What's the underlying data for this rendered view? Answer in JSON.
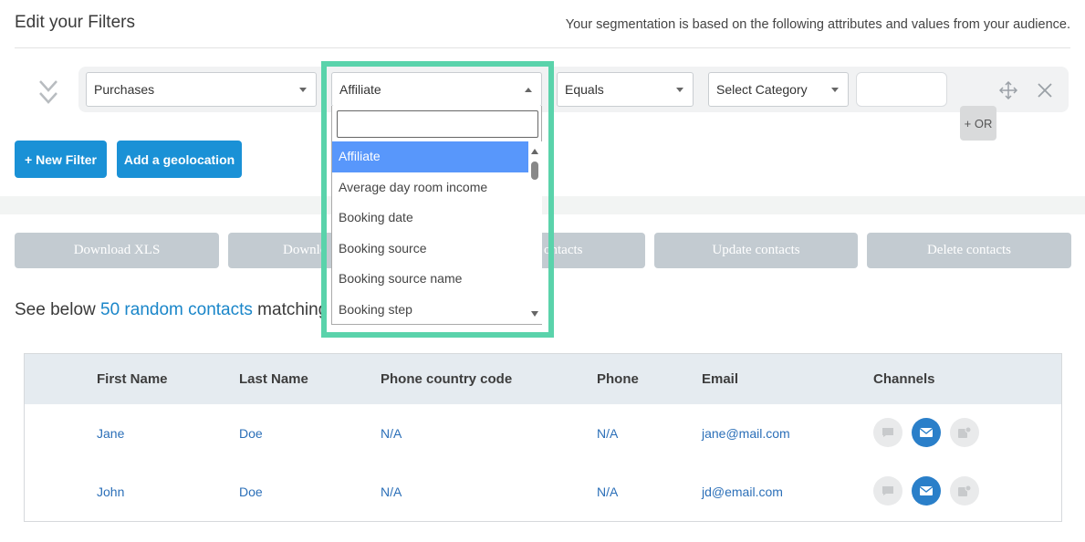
{
  "header": {
    "title": "Edit your Filters",
    "description": "Your segmentation is based on the following attributes and values from your audience."
  },
  "filter": {
    "attribute": "Purchases",
    "field": "Affiliate",
    "operator": "Equals",
    "category": "Select Category",
    "value": "",
    "or_label": "+ OR"
  },
  "dropdown": {
    "search_value": "",
    "options": [
      "Affiliate",
      "Average day room income",
      "Booking date",
      "Booking source",
      "Booking source name",
      "Booking step"
    ],
    "selected": "Affiliate"
  },
  "actions": {
    "new_filter": "+ New Filter",
    "add_geolocation": "Add a geolocation"
  },
  "export_buttons": {
    "download_xls": "Download XLS",
    "download_csv_partial": "Downlo",
    "contacts_partial": "ontacts",
    "update_contacts": "Update contacts",
    "delete_contacts": "Delete contacts"
  },
  "summary": {
    "prefix": "See below ",
    "link": "50 random contacts",
    "suffix": " matching yo"
  },
  "table": {
    "columns": [
      "First Name",
      "Last Name",
      "Phone country code",
      "Phone",
      "Email",
      "Channels"
    ],
    "rows": [
      {
        "first_name": "Jane",
        "last_name": "Doe",
        "phone_country_code": "N/A",
        "phone": "N/A",
        "email": "jane@mail.com"
      },
      {
        "first_name": "John",
        "last_name": "Doe",
        "phone_country_code": "N/A",
        "phone": "N/A",
        "email": "jd@email.com"
      }
    ]
  },
  "colors": {
    "primary": "#1a91d6",
    "highlight": "#5ad3ab",
    "selected_option": "#5897fb",
    "disabled_button": "#c3cbd1",
    "link": "#2b6fb8"
  },
  "icons": {
    "collapse": "double-chevron-down-icon",
    "move": "move-icon",
    "close": "close-icon",
    "sms": "sms-icon",
    "email": "email-icon",
    "push": "push-icon"
  }
}
